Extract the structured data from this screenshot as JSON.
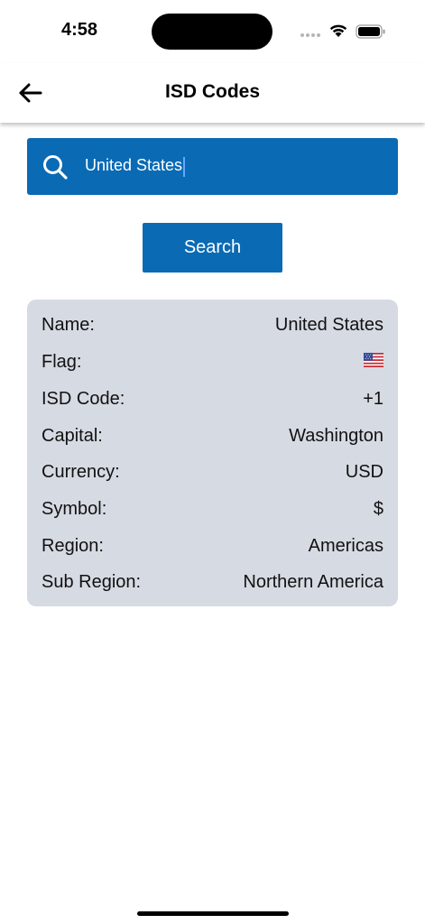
{
  "status_bar": {
    "time": "4:58"
  },
  "header": {
    "title": "ISD Codes",
    "back_icon": "arrow-left-icon"
  },
  "search": {
    "value": "United States",
    "icon": "search-icon",
    "button_label": "Search"
  },
  "result": {
    "rows": [
      {
        "label": "Name:",
        "value": "United States"
      },
      {
        "label": "Flag:",
        "value": "🇺🇸"
      },
      {
        "label": "ISD Code:",
        "value": "+1"
      },
      {
        "label": "Capital:",
        "value": "Washington"
      },
      {
        "label": "Currency:",
        "value": "USD"
      },
      {
        "label": "Symbol:",
        "value": "$"
      },
      {
        "label": "Region:",
        "value": "Americas"
      },
      {
        "label": "Sub Region:",
        "value": "Northern America"
      }
    ]
  },
  "colors": {
    "primary": "#0a6ab4",
    "card_background": "#d6dae3",
    "text": "#111111"
  }
}
